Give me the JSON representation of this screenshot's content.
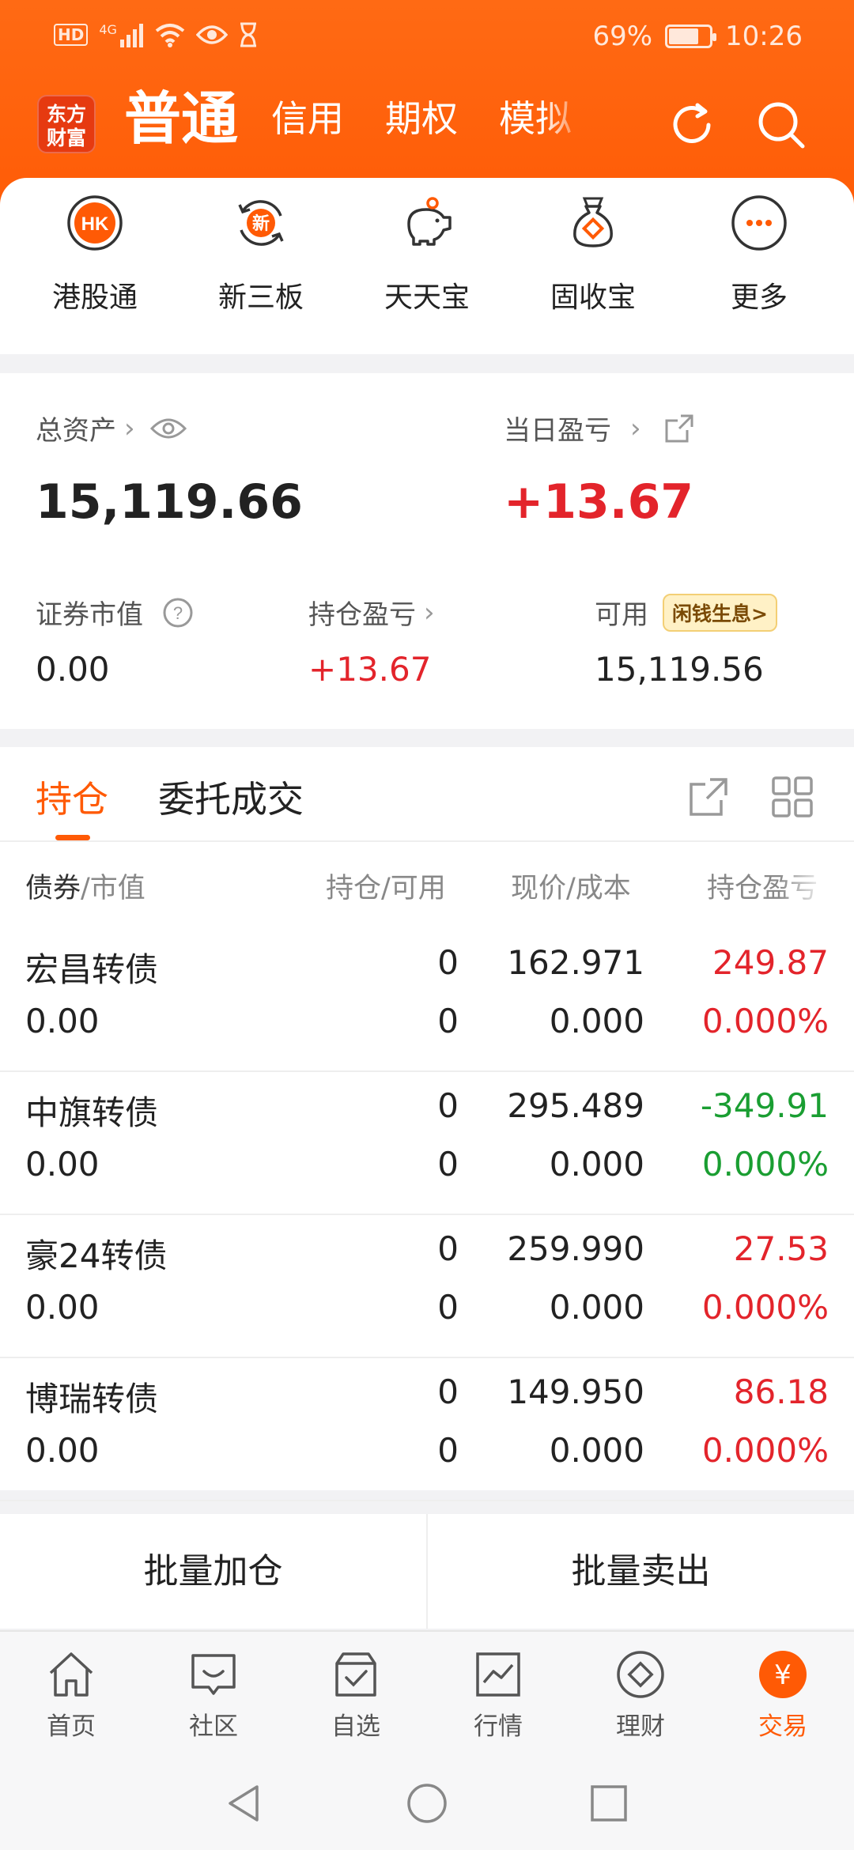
{
  "status_bar": {
    "hd": "HD",
    "net": "4G",
    "battery": "69%",
    "time": "10:26"
  },
  "header": {
    "logo_line1": "东方",
    "logo_line2": "财富",
    "tabs": [
      {
        "label": "普通",
        "active": true
      },
      {
        "label": "信用"
      },
      {
        "label": "期权"
      },
      {
        "label": "模拟"
      }
    ]
  },
  "quick_links": [
    {
      "label": "港股通",
      "icon": "hk-icon",
      "icon_text": "HK"
    },
    {
      "label": "新三板",
      "icon": "new-board-icon",
      "icon_text": "新"
    },
    {
      "label": "天天宝",
      "icon": "piggy-bank-icon"
    },
    {
      "label": "固收宝",
      "icon": "money-bag-icon"
    },
    {
      "label": "更多",
      "icon": "more-icon"
    }
  ],
  "assets": {
    "total_label": "总资产",
    "total_value": "15,119.66",
    "daily_pl_label": "当日盈亏",
    "daily_pl_value": "+13.67",
    "securities_label": "证券市值",
    "securities_value": "0.00",
    "position_pl_label": "持仓盈亏",
    "position_pl_value": "+13.67",
    "available_label": "可用",
    "available_badge": "闲钱生息>",
    "available_value": "15,119.56"
  },
  "holdings": {
    "tabs": [
      {
        "label": "持仓",
        "active": true
      },
      {
        "label": "委托成交"
      }
    ],
    "headers": {
      "col1_a": "债券",
      "col1_b": "/市值",
      "col2": "持仓/可用",
      "col3": "现价/成本",
      "col4": "持仓盈亏"
    },
    "rows": [
      {
        "name": "宏昌转债",
        "market_value": "0.00",
        "position": "0",
        "available": "0",
        "price": "162.971",
        "cost": "0.000",
        "pl": "249.87",
        "pl_pct": "0.000%",
        "trend": "up"
      },
      {
        "name": "中旗转债",
        "market_value": "0.00",
        "position": "0",
        "available": "0",
        "price": "295.489",
        "cost": "0.000",
        "pl": "-349.91",
        "pl_pct": "0.000%",
        "trend": "down"
      },
      {
        "name": "豪24转债",
        "market_value": "0.00",
        "position": "0",
        "available": "0",
        "price": "259.990",
        "cost": "0.000",
        "pl": "27.53",
        "pl_pct": "0.000%",
        "trend": "up"
      },
      {
        "name": "博瑞转债",
        "market_value": "0.00",
        "position": "0",
        "available": "0",
        "price": "149.950",
        "cost": "0.000",
        "pl": "86.18",
        "pl_pct": "0.000%",
        "trend": "up"
      }
    ]
  },
  "batch": {
    "add": "批量加仓",
    "sell": "批量卖出"
  },
  "bottom_nav": [
    {
      "label": "首页",
      "icon": "home-icon"
    },
    {
      "label": "社区",
      "icon": "community-icon"
    },
    {
      "label": "自选",
      "icon": "watchlist-icon"
    },
    {
      "label": "行情",
      "icon": "market-icon"
    },
    {
      "label": "理财",
      "icon": "wealth-icon"
    },
    {
      "label": "交易",
      "icon": "trade-icon",
      "active": true,
      "icon_text": "¥"
    }
  ],
  "colors": {
    "accent": "#ff5a05",
    "up": "#e3242b",
    "down": "#1a9e32"
  }
}
